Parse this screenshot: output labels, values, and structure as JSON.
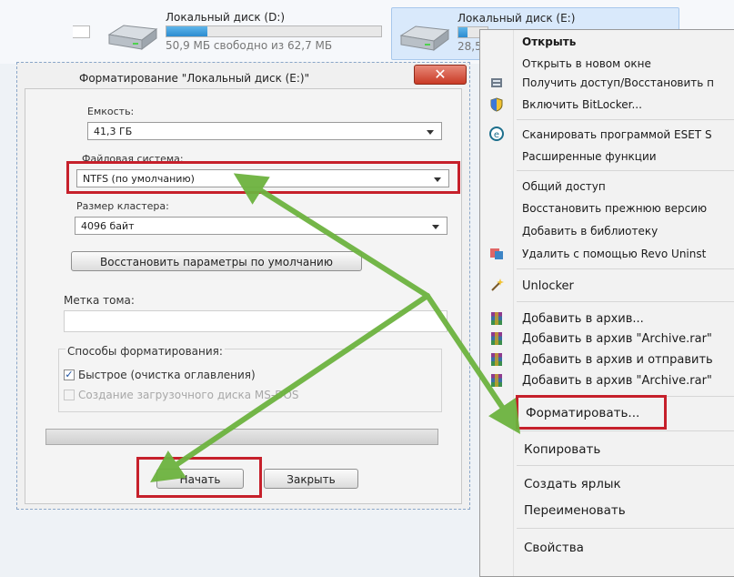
{
  "explorer": {
    "drive_d": {
      "name": "Локальный диск (D:)",
      "free": "50,9 МБ свободно из 62,7 МБ",
      "used_fraction": 0.19
    },
    "drive_e": {
      "name": "Локальный диск (E:)",
      "free": "28,5",
      "used_fraction": 0.3
    }
  },
  "dialog": {
    "title": "Форматирование \"Локальный диск (E:)\"",
    "close_label": "✕",
    "capacity_label": "Емкость:",
    "capacity_value": "41,3 ГБ",
    "fs_label": "Файловая система:",
    "fs_value": "NTFS (по умолчанию)",
    "cluster_label": "Размер кластера:",
    "cluster_value": "4096 байт",
    "restore_button": "Восстановить параметры по умолчанию",
    "volume_label": "Метка тома:",
    "volume_value": "",
    "methods_label": "Способы форматирования:",
    "quick_label": "Быстрое (очистка оглавления)",
    "quick_checked": true,
    "bootdisk_label": "Создание загрузочного диска MS-DOS",
    "start_button": "Начать",
    "close_button": "Закрыть"
  },
  "menu": {
    "items": [
      {
        "label": "Открыть",
        "bold": true
      },
      {
        "label": "Открыть в новом окне"
      },
      {
        "label": "Получить доступ/Восстановить п",
        "icon": "admin-icon"
      },
      {
        "label": "Включить BitLocker...",
        "icon": "shield-icon"
      },
      {
        "label": "Сканировать программой ESET S",
        "icon": "eset-icon"
      },
      {
        "label": "Расширенные функции"
      },
      {
        "label": "Общий доступ"
      },
      {
        "label": "Восстановить прежнюю версию"
      },
      {
        "label": "Добавить в библиотеку"
      },
      {
        "label": "Удалить с помощью Revo Uninst",
        "icon": "revo-icon"
      },
      {
        "label": "Unlocker",
        "icon": "unlocker-wand-icon"
      },
      {
        "label": "Добавить в архив...",
        "icon": "winrar-icon"
      },
      {
        "label": "Добавить в архив \"Archive.rar\"",
        "icon": "winrar-icon"
      },
      {
        "label": "Добавить в архив и отправить",
        "icon": "winrar-icon"
      },
      {
        "label": "Добавить в архив \"Archive.rar\"",
        "icon": "winrar-icon"
      },
      {
        "label": "Форматировать..."
      },
      {
        "label": "Копировать"
      },
      {
        "label": "Создать ярлык"
      },
      {
        "label": "Переименовать"
      },
      {
        "label": "Свойства"
      }
    ]
  },
  "colors": {
    "highlight_red": "#c6202b",
    "arrow_green": "#6db33f",
    "accent_blue": "#2b8bd0"
  }
}
